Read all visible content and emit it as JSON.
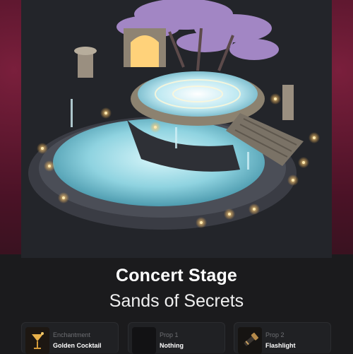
{
  "scene": {
    "title": "Concert Stage",
    "subtitle": "Sands of Secrets"
  },
  "slots": [
    {
      "label": "Enchantment",
      "value": "Golden Cocktail",
      "icon": "cocktail-icon"
    },
    {
      "label": "Prop 1",
      "value": "Nothing",
      "icon": "empty-slot-icon"
    },
    {
      "label": "Prop 2",
      "value": "Flashlight",
      "icon": "flashlight-icon"
    }
  ],
  "colors": {
    "background": "#1a1a1c",
    "card": "#252628",
    "side_panel": "#5a1730",
    "water": "#8fd3e0",
    "gold_light": "#ffc966",
    "tree_blossom": "#c9a8e8"
  }
}
